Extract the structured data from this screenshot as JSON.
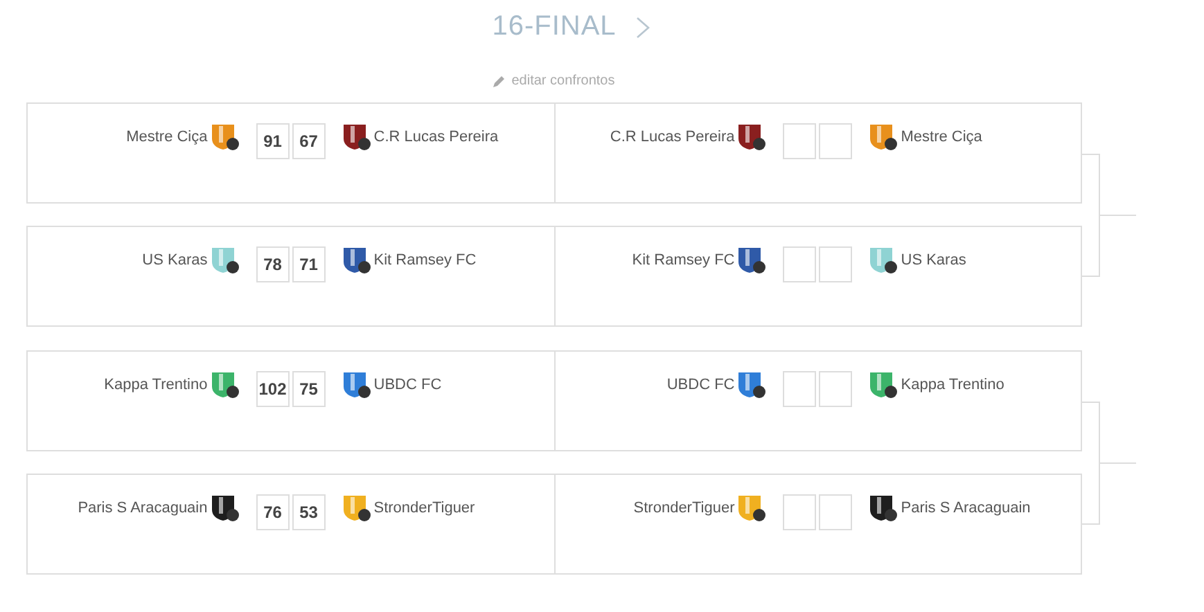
{
  "round": {
    "title": "16-FINAL",
    "edit_link": "editar confrontos"
  },
  "groups": [
    {
      "matches": [
        {
          "legs": [
            {
              "home": {
                "name": "Mestre Ciça",
                "color": "#e8901c"
              },
              "home_score": "91",
              "away_score": "67",
              "away": {
                "name": "C.R Lucas Pereira",
                "color": "#8a1f1f"
              }
            },
            {
              "home": {
                "name": "C.R Lucas Pereira",
                "color": "#8a1f1f"
              },
              "away": {
                "name": "Mestre Ciça",
                "color": "#e8901c"
              }
            }
          ]
        },
        {
          "legs": [
            {
              "home": {
                "name": "US Karas",
                "color": "#8fd3d3"
              },
              "home_score": "78",
              "away_score": "71",
              "away": {
                "name": "Kit Ramsey FC",
                "color": "#2f5aa8"
              }
            },
            {
              "home": {
                "name": "Kit Ramsey FC",
                "color": "#2f5aa8"
              },
              "away": {
                "name": "US Karas",
                "color": "#8fd3d3"
              }
            }
          ]
        }
      ]
    },
    {
      "matches": [
        {
          "legs": [
            {
              "home": {
                "name": "Kappa Trentino",
                "color": "#3cb46a"
              },
              "home_score": "102",
              "away_score": "75",
              "away": {
                "name": "UBDC FC",
                "color": "#2f7ed8"
              }
            },
            {
              "home": {
                "name": "UBDC FC",
                "color": "#2f7ed8"
              },
              "away": {
                "name": "Kappa Trentino",
                "color": "#3cb46a"
              }
            }
          ]
        },
        {
          "legs": [
            {
              "home": {
                "name": "Paris S Aracaguain",
                "color": "#1e1e1e"
              },
              "home_score": "76",
              "away_score": "53",
              "away": {
                "name": "StronderTiguer",
                "color": "#f0b020"
              }
            },
            {
              "home": {
                "name": "StronderTiguer",
                "color": "#f0b020"
              },
              "away": {
                "name": "Paris S Aracaguain",
                "color": "#1e1e1e"
              }
            }
          ]
        }
      ]
    }
  ]
}
